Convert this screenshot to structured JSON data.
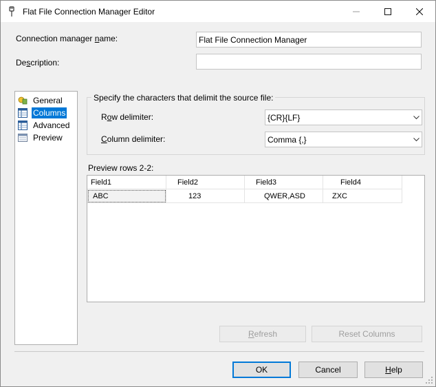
{
  "window": {
    "title": "Flat File Connection Manager Editor"
  },
  "fields": {
    "connection_name_label": {
      "pre": "Connection manager ",
      "key": "n",
      "post": "ame:"
    },
    "connection_name_value": "Flat File Connection Manager",
    "description_label": {
      "pre": "De",
      "key": "s",
      "post": "cription:"
    },
    "description_value": ""
  },
  "nav": {
    "items": [
      {
        "label": "General",
        "selected": false,
        "icon": "general-icon"
      },
      {
        "label": "Columns",
        "selected": true,
        "icon": "columns-icon"
      },
      {
        "label": "Advanced",
        "selected": false,
        "icon": "advanced-icon"
      },
      {
        "label": "Preview",
        "selected": false,
        "icon": "preview-icon"
      }
    ]
  },
  "delimiters": {
    "group_title": "Specify the characters that delimit the source file:",
    "row_label": {
      "pre": "R",
      "key": "o",
      "post": "w delimiter:"
    },
    "row_value": "{CR}{LF}",
    "column_label": {
      "pre": "",
      "key": "C",
      "post": "olumn delimiter:"
    },
    "column_value": "Comma {,}"
  },
  "preview": {
    "label": "Preview rows 2-2:",
    "headers": [
      "Field1",
      "Field2",
      "Field3",
      "Field4"
    ],
    "rows": [
      [
        "ABC",
        "123",
        "QWER,ASD",
        "ZXC"
      ]
    ]
  },
  "buttons": {
    "refresh": {
      "pre": "",
      "key": "R",
      "post": "efresh"
    },
    "reset_columns": "Reset Columns",
    "ok": "OK",
    "cancel": "Cancel",
    "help": {
      "pre": "",
      "key": "H",
      "post": "elp"
    }
  },
  "colors": {
    "selection": "#0078d7",
    "window_bg": "#f0f0f0"
  }
}
